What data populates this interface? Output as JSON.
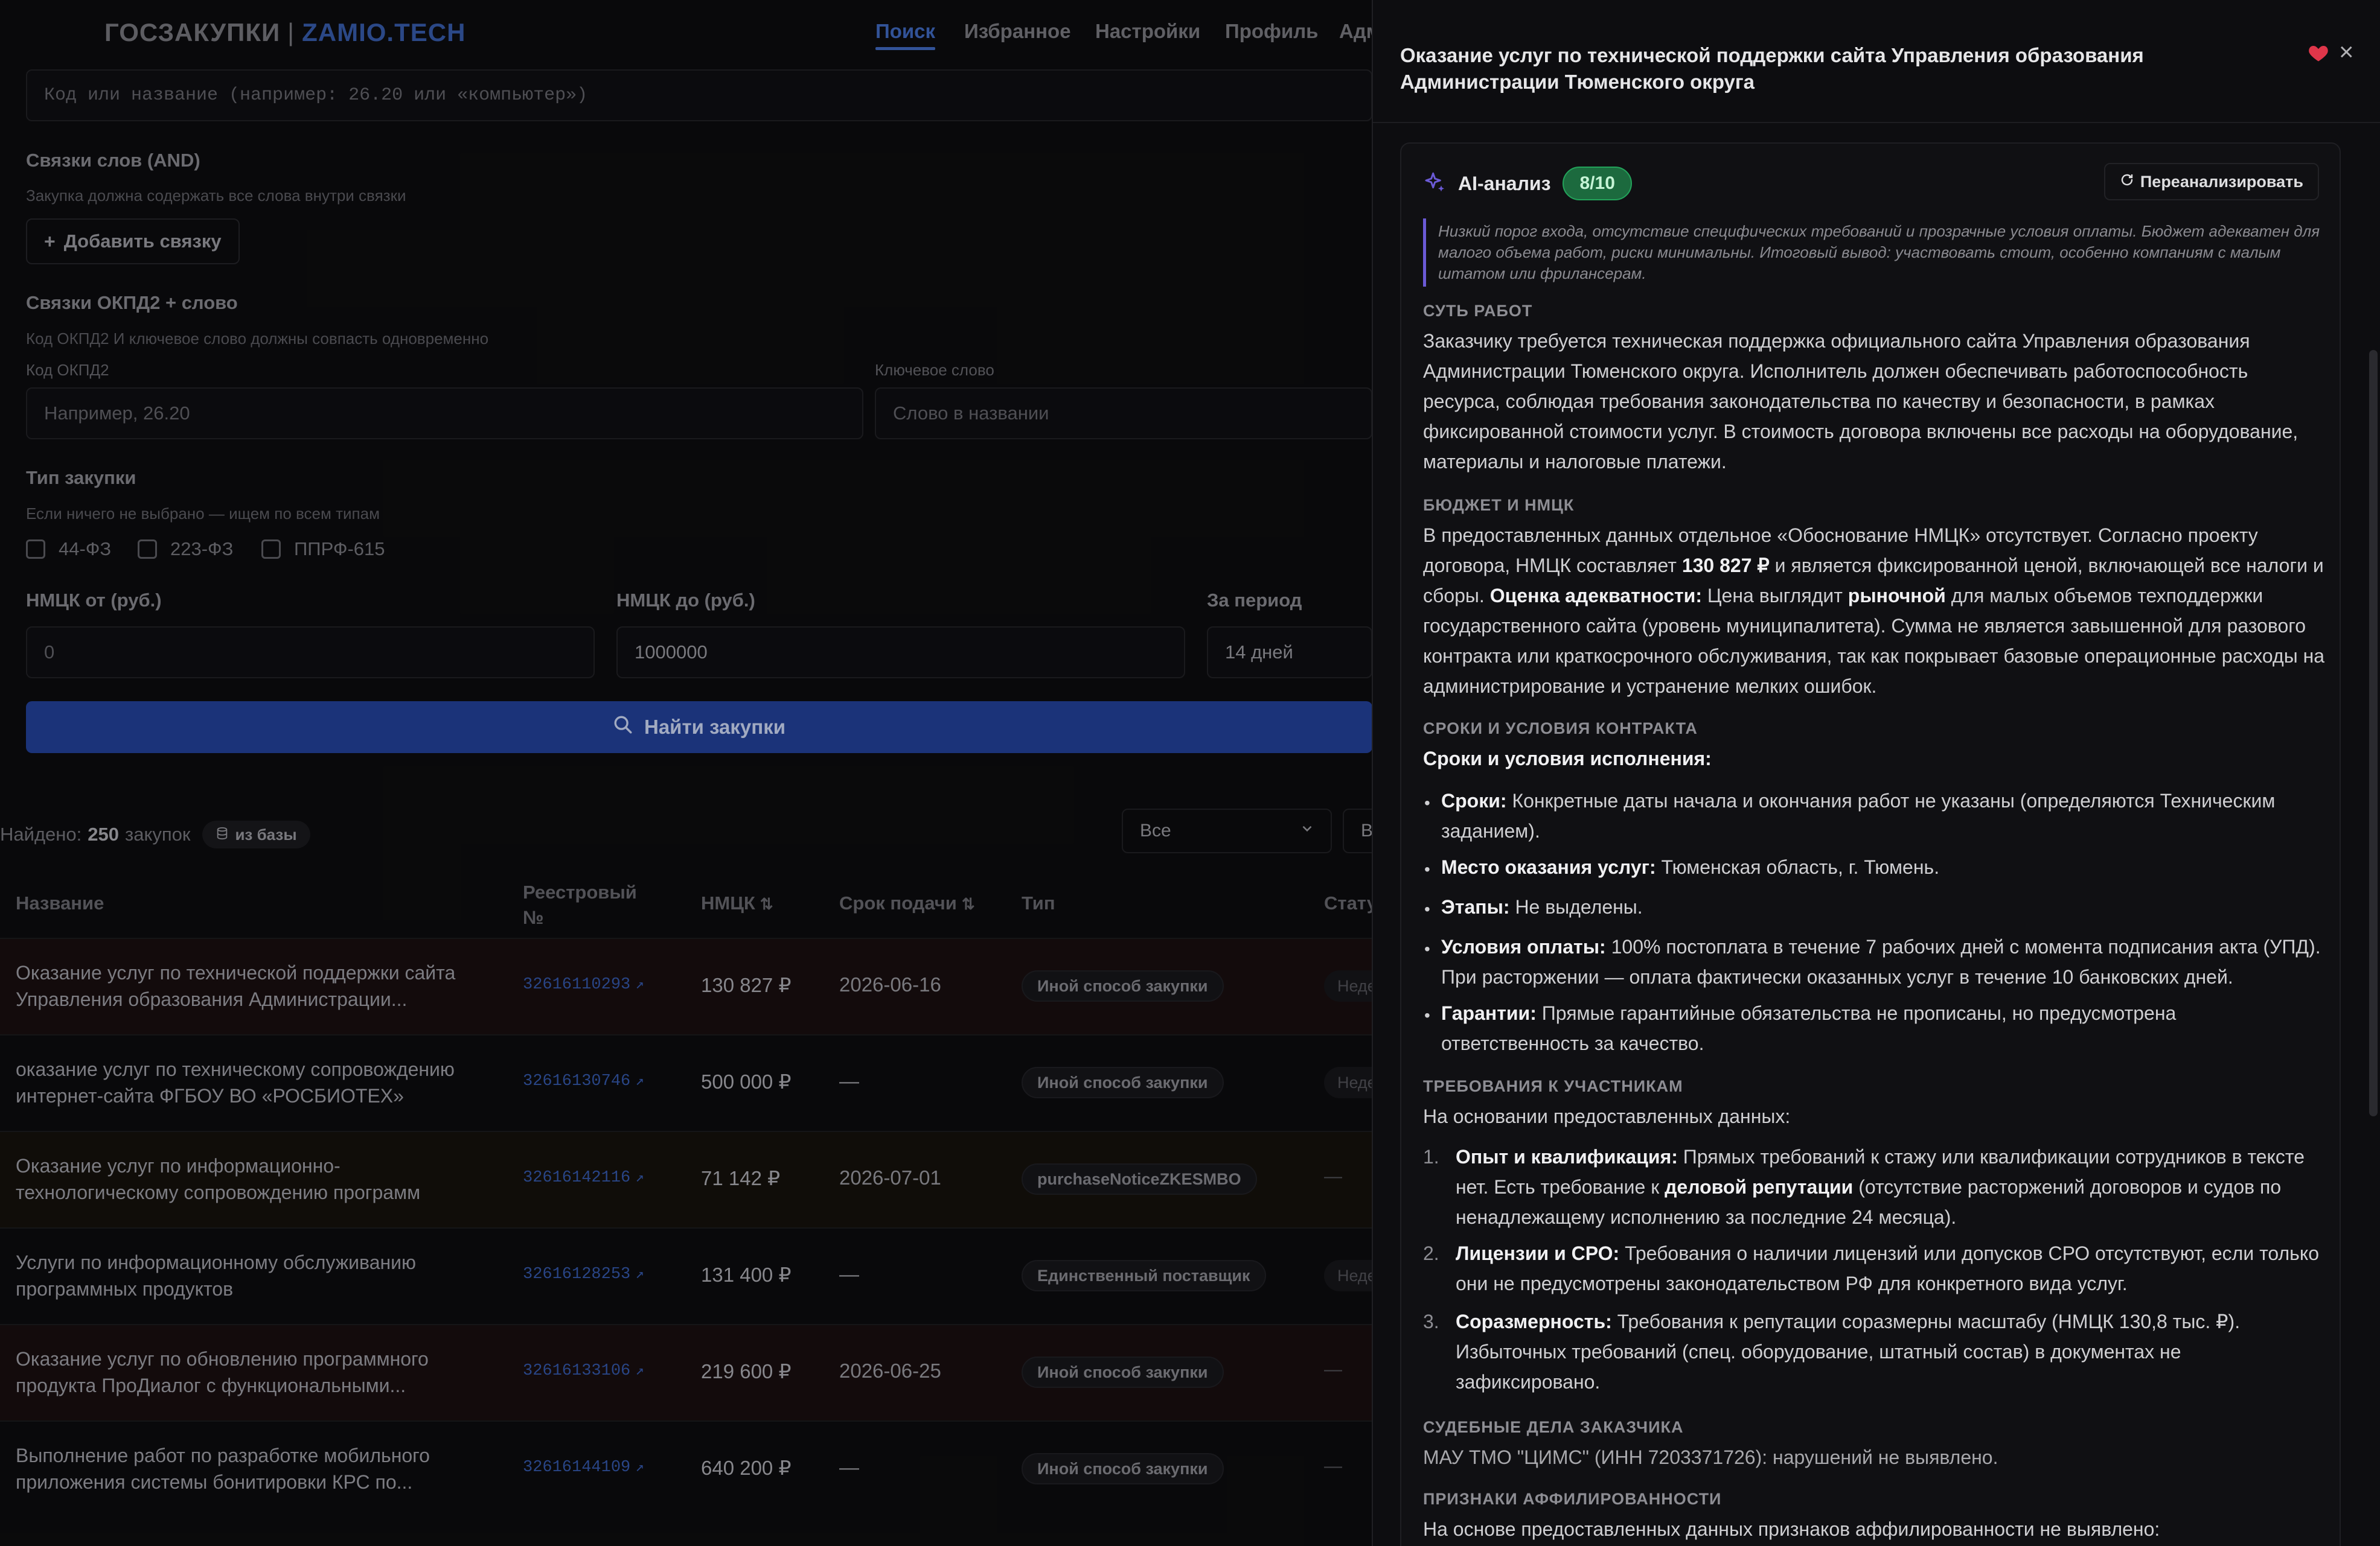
{
  "nav": {
    "logo_part1": "ГОСЗАКУПКИ",
    "logo_sep": "|",
    "logo_part2": "ZAMIO.TECH",
    "links": [
      "Поиск",
      "Избранное",
      "Настройки",
      "Профиль",
      "Адм"
    ]
  },
  "filters": {
    "okpd_placeholder": "Код или название (например: 26.20 или «компьютер»)",
    "word_links_label": "Связки слов (AND)",
    "word_links_hint": "Закупка должна содержать все слова внутри связки",
    "add_link_button": "Добавить связку",
    "okpd_links_label": "Связки ОКПД2 + слово",
    "okpd_links_hint": "Код ОКПД2 И ключевое слово должны совпасть одновременно",
    "okpd_code_label": "Код ОКПД2",
    "okpd_code_placeholder": "Например, 26.20",
    "keyword_label": "Ключевое слово",
    "keyword_placeholder": "Слово в названии",
    "type_label": "Тип закупки",
    "type_hint": "Если ничего не выбрано — ищем по всем типам",
    "types": [
      "44-ФЗ",
      "223-ФЗ",
      "ППРФ-615"
    ],
    "nmck_from_label": "НМЦК от (руб.)",
    "nmck_from_value": "0",
    "nmck_to_label": "НМЦК до (руб.)",
    "nmck_to_value": "1000000",
    "period_label": "За период",
    "period_value": "14 дней",
    "search_button": "Найти закупки"
  },
  "results": {
    "found_prefix": "Найдено:",
    "found_count": "250",
    "found_suffix": "закупок",
    "source_badge": "из базы",
    "filter_select": "Все",
    "filter_select2": "В",
    "columns": [
      "Название",
      "Реестровый №",
      "НМЦК",
      "Срок подачи",
      "Тип",
      "Стату"
    ],
    "rows": [
      {
        "name": "Оказание услуг по технической поддержки сайта Управления образования Администрации...",
        "reg": "32616110293",
        "price": "130 827 ₽",
        "deadline": "2026-06-16",
        "type": "Иной способ закупки",
        "status": "Неде"
      },
      {
        "name": "оказание услуг по техническому сопровождению интернет-сайта ФГБОУ ВО «РОСБИОТЕХ»",
        "reg": "32616130746",
        "price": "500 000 ₽",
        "deadline": "—",
        "type": "Иной способ закупки",
        "status": "Неде"
      },
      {
        "name": "Оказание услуг по информационно-технологическому сопровождению программ",
        "reg": "32616142116",
        "price": "71 142 ₽",
        "deadline": "2026-07-01",
        "type": "purchaseNoticeZKESMBO",
        "status": "—"
      },
      {
        "name": "Услуги по информационному обслуживанию программных продуктов",
        "reg": "32616128253",
        "price": "131 400 ₽",
        "deadline": "—",
        "type": "Единственный поставщик",
        "status": "Неде"
      },
      {
        "name": "Оказание услуг по обновлению программного продукта ПроДиалог с функциональными...",
        "reg": "32616133106",
        "price": "219 600 ₽",
        "deadline": "2026-06-25",
        "type": "Иной способ закупки",
        "status": "—"
      },
      {
        "name": "Выполнение работ по разработке мобильного приложения системы бонитировки КРС по...",
        "reg": "32616144109",
        "price": "640 200 ₽",
        "deadline": "—",
        "type": "Иной способ закупки",
        "status": "—"
      }
    ]
  },
  "panel": {
    "title": "Оказание услуг по технической поддержки сайта Управления образования Администрации Тюменского округа",
    "ai_label": "AI-анализ",
    "score": "8/10",
    "reanalyze_button": "Переанализировать",
    "summary": "Низкий порог входа, отсутствие специфических требований и прозрачные условия оплаты. Бюджет адекватен для малого объема работ, риски минимальны. Итоговый вывод: участвовать стоит, особенно компаниям с малым штатом или фрилансерам.",
    "s1_head": "СУТЬ РАБОТ",
    "s1_text": "Заказчику требуется техническая поддержка официального сайта Управления образования Администрации Тюменского округа. Исполнитель должен обеспечивать работоспособность ресурса, соблюдая требования законодательства по качеству и безопасности, в рамках фиксированной стоимости услуг. В стоимость договора включены все расходы на оборудование, материалы и налоговые платежи.",
    "s2_head": "БЮДЖЕТ И НМЦК",
    "s2_t1": "В предоставленных данных отдельное «Обоснование НМЦК» отсутствует. Согласно проекту договора, НМЦК составляет",
    "s2_b1": "130 827 ₽",
    "s2_t2": "и является фиксированной ценой, включающей все налоги и сборы.",
    "s2_b2": "Оценка адекватности:",
    "s2_t3": "Цена выглядит",
    "s2_b3": "рыночной",
    "s2_t4": "для малых объемов техподдержки государственного сайта (уровень муниципалитета). Сумма не является завышенной для разового контракта или краткосрочного обслуживания, так как покрывает базовые операционные расходы на администрирование и устранение мелких ошибок.",
    "s3_head": "СРОКИ И УСЛОВИЯ КОНТРАКТА",
    "s3_sub": "Сроки и условия исполнения:",
    "s3_items": [
      {
        "b": "Сроки:",
        "t": "Конкретные даты начала и окончания работ не указаны (определяются Техническим заданием)."
      },
      {
        "b": "Место оказания услуг:",
        "t": "Тюменская область, г. Тюмень."
      },
      {
        "b": "Этапы:",
        "t": "Не выделены."
      },
      {
        "b": "Условия оплаты:",
        "t": "100% постоплата в течение 7 рабочих дней с момента подписания акта (УПД). При расторжении — оплата фактически оказанных услуг в течение 10 банковских дней."
      },
      {
        "b": "Гарантии:",
        "t": "Прямые гарантийные обязательства не прописаны, но предусмотрена ответственность за качество."
      }
    ],
    "s4_head": "ТРЕБОВАНИЯ К УЧАСТНИКАМ",
    "s4_intro": "На основании предоставленных данных:",
    "s4_items": [
      {
        "n": "1.",
        "b": "Опыт и квалификация:",
        "t1": "Прямых требований к стажу или квалификации сотрудников в тексте нет. Есть требование к",
        "b2": "деловой репутации",
        "t2": "(отсутствие расторжений договоров и судов по ненадлежащему исполнению за последние 24 месяца)."
      },
      {
        "n": "2.",
        "b": "Лицензии и СРО:",
        "t1": "Требования о наличии лицензий или допусков СРО отсутствуют, если только они не предусмотрены законодательством РФ для конкретного вида услуг.",
        "b2": "",
        "t2": ""
      },
      {
        "n": "3.",
        "b": "Соразмерность:",
        "t1": "Требования к репутации соразмерны масштабу (НМЦК 130,8 тыс. ₽). Избыточных требований (спец. оборудование, штатный состав) в документах не зафиксировано.",
        "b2": "",
        "t2": ""
      }
    ],
    "s5_head": "СУДЕБНЫЕ ДЕЛА ЗАКАЗЧИКА",
    "s5_text": "МАУ ТМО \"ЦИМС\" (ИНН 7203371726): нарушений не выявлено.",
    "s6_head": "ПРИЗНАКИ АФФИЛИРОВАННОСТИ",
    "s6_text": "На основе предоставленных данных признаков аффилированности не выявлено:"
  },
  "colors": {
    "accent": "#3a5fae",
    "score_bg": "#1c6a3e",
    "heart": "#e0364a",
    "ai_icon": "#6b5ad6"
  },
  "icons": [
    "search-icon",
    "plus-icon",
    "database-icon",
    "chevron-down-icon",
    "sort-icon",
    "external-link-icon",
    "heart-icon",
    "close-icon",
    "sparkle-icon",
    "refresh-icon"
  ]
}
